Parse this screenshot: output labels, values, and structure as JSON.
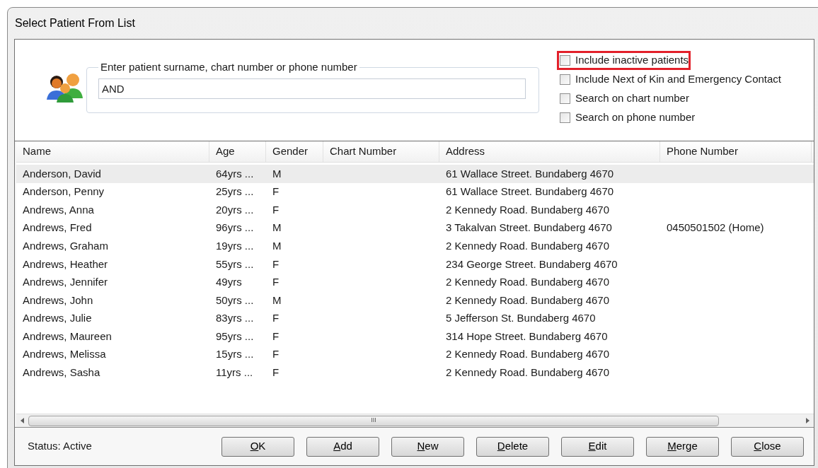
{
  "window": {
    "title": "Select Patient From List"
  },
  "search": {
    "legend": "Enter patient surname, chart number or phone number",
    "value": "AND"
  },
  "options": [
    {
      "label": "Include inactive patients",
      "checked": false,
      "highlighted": true
    },
    {
      "label": "Include Next of Kin and Emergency Contact",
      "checked": false,
      "highlighted": false
    },
    {
      "label": "Search on chart number",
      "checked": false,
      "highlighted": false
    },
    {
      "label": "Search on phone number",
      "checked": false,
      "highlighted": false
    }
  ],
  "table": {
    "columns": [
      "Name",
      "Age",
      "Gender",
      "Chart Number",
      "Address",
      "Phone Number"
    ],
    "rows": [
      {
        "selected": true,
        "cells": [
          "Anderson, David",
          "64yrs ...",
          "M",
          "",
          "61 Wallace Street. Bundaberg 4670",
          ""
        ]
      },
      {
        "selected": false,
        "cells": [
          "Anderson, Penny",
          "25yrs ...",
          "F",
          "",
          "61 Wallace Street. Bundaberg 4670",
          ""
        ]
      },
      {
        "selected": false,
        "cells": [
          "Andrews, Anna",
          "20yrs ...",
          "F",
          "",
          "2 Kennedy Road. Bundaberg 4670",
          ""
        ]
      },
      {
        "selected": false,
        "cells": [
          "Andrews, Fred",
          "96yrs ...",
          "M",
          "",
          "3 Takalvan Street. Bundaberg 4670",
          "0450501502 (Home)"
        ]
      },
      {
        "selected": false,
        "cells": [
          "Andrews, Graham",
          "19yrs ...",
          "M",
          "",
          "2 Kennedy Road. Bundaberg 4670",
          ""
        ]
      },
      {
        "selected": false,
        "cells": [
          "Andrews, Heather",
          "55yrs ...",
          "F",
          "",
          "234 George Street. Bundaberg 4670",
          ""
        ]
      },
      {
        "selected": false,
        "cells": [
          "Andrews, Jennifer",
          "49yrs",
          "F",
          "",
          "2 Kennedy Road. Bundaberg 4670",
          ""
        ]
      },
      {
        "selected": false,
        "cells": [
          "Andrews, John",
          "50yrs ...",
          "M",
          "",
          "2 Kennedy Road. Bundaberg 4670",
          ""
        ]
      },
      {
        "selected": false,
        "cells": [
          "Andrews, Julie",
          "83yrs ...",
          "F",
          "",
          "5 Jefferson St. Bundaberg 4670",
          ""
        ]
      },
      {
        "selected": false,
        "cells": [
          "Andrews, Maureen",
          "95yrs ...",
          "F",
          "",
          "314 Hope Street. Bundaberg 4670",
          ""
        ]
      },
      {
        "selected": false,
        "cells": [
          "Andrews, Melissa",
          "15yrs ...",
          "F",
          "",
          "2 Kennedy Road. Bundaberg 4670",
          ""
        ]
      },
      {
        "selected": false,
        "cells": [
          "Andrews, Sasha",
          "11yrs ...",
          "F",
          "",
          "2 Kennedy Road. Bundaberg 4670",
          ""
        ]
      }
    ]
  },
  "scrollbar": {
    "grip": "III"
  },
  "status": "Status: Active",
  "buttons": [
    "OK",
    "Add",
    "New",
    "Delete",
    "Edit",
    "Merge",
    "Close"
  ]
}
